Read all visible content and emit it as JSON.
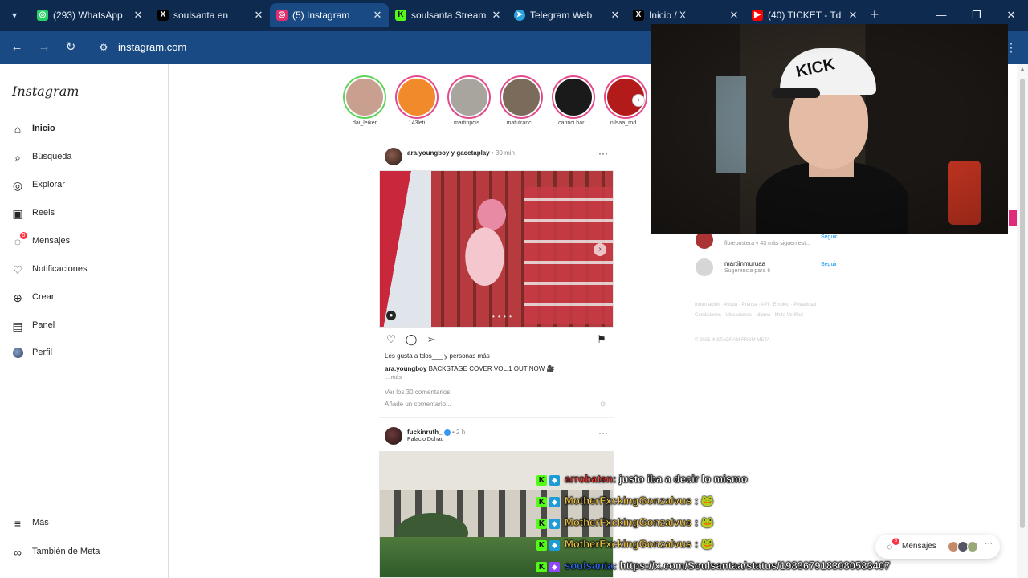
{
  "browser": {
    "tabs": [
      {
        "title": "(293) WhatsApp",
        "icon": "whatsapp-icon",
        "color": "#25d366",
        "glyph": "◎",
        "active": false
      },
      {
        "title": "soulsanta en",
        "icon": "x-icon",
        "color": "#000000",
        "glyph": "X",
        "active": false
      },
      {
        "title": "(5) Instagram",
        "icon": "instagram-icon",
        "color": "#e1306c",
        "glyph": "◎",
        "active": true
      },
      {
        "title": "soulsanta Stream",
        "icon": "kick-icon",
        "color": "#53fc18",
        "glyph": "K",
        "active": false
      },
      {
        "title": "Telegram Web",
        "icon": "telegram-icon",
        "color": "#2aa3df",
        "glyph": "➤",
        "active": false
      },
      {
        "title": "Inicio / X",
        "icon": "x-icon",
        "color": "#000000",
        "glyph": "X",
        "active": false
      },
      {
        "title": "(40) TICKET - Td",
        "icon": "youtube-icon",
        "color": "#ff0000",
        "glyph": "▶",
        "active": false
      }
    ],
    "url": "instagram.com"
  },
  "sidebar": {
    "logo": "Instagram",
    "items": [
      {
        "label": "Inicio",
        "icon": "home-icon",
        "glyph": "⌂"
      },
      {
        "label": "Búsqueda",
        "icon": "search-icon",
        "glyph": "⌕"
      },
      {
        "label": "Explorar",
        "icon": "compass-icon",
        "glyph": "◎"
      },
      {
        "label": "Reels",
        "icon": "reels-icon",
        "glyph": "▣"
      },
      {
        "label": "Mensajes",
        "icon": "messenger-icon",
        "glyph": "◌",
        "badge": "5"
      },
      {
        "label": "Notificaciones",
        "icon": "heart-icon",
        "glyph": "♡"
      },
      {
        "label": "Crear",
        "icon": "plus-icon",
        "glyph": "⊕"
      },
      {
        "label": "Panel",
        "icon": "dashboard-icon",
        "glyph": "▤"
      },
      {
        "label": "Perfil",
        "icon": "avatar",
        "glyph": ""
      },
      {
        "label": "Más",
        "icon": "menu-icon",
        "glyph": "≡"
      },
      {
        "label": "También de Meta",
        "icon": "meta-icon",
        "glyph": "∞"
      }
    ]
  },
  "stories": [
    {
      "name": "dai_leiker",
      "ring": "#5fd35a",
      "color": "#c9a08f"
    },
    {
      "name": "143leti",
      "ring": "#e34a8c",
      "color": "#f08a2a"
    },
    {
      "name": "martinpdis...",
      "ring": "#e34a8c",
      "color": "#a7a59d"
    },
    {
      "name": "matufranc...",
      "ring": "#e34a8c",
      "color": "#7b6b5a"
    },
    {
      "name": "carinci.bar...",
      "ring": "#e34a8c",
      "color": "#1a1a1a"
    },
    {
      "name": "nilsaa_rod...",
      "ring": "#e34a8c",
      "color": "#b31b1b"
    }
  ],
  "post1": {
    "user": "ara.youngboy y gacetaplay",
    "time": " • 30 min",
    "likes": "Les gusta a tdos___ y personas más",
    "caption_user": "ara.youngboy",
    "caption": " BACKSTAGE COVER VOL.1 OUT NOW 🎥",
    "more": "... más",
    "comments": "Ver los 30 comentarios",
    "add_comment": "Añade un comentario...",
    "pager": "• • • •"
  },
  "post2": {
    "user": "fuckinruth_",
    "time": " • 2 h",
    "location": "Palacio Duhau"
  },
  "suggestions": [
    {
      "name": "",
      "sub": "florebostera y 43 más siguen est...",
      "follow": "Seguir",
      "color": "#a33"
    },
    {
      "name": "martiinmuruaa",
      "sub": "Sugerencia para ti",
      "follow": "Seguir",
      "color": "#cfcfcf"
    }
  ],
  "footer": {
    "links": "Información · Ayuda · Prensa · API · Empleo · Privacidad · Condiciones · Ubicaciones · Idioma · Meta Verified",
    "copyright": "© 2025 INSTAGRAM FROM META"
  },
  "chat": [
    {
      "user": "arrobaten",
      "user_color": "#ff3b3b",
      "message": ": justo iba a decir lo mismo",
      "emote": ""
    },
    {
      "user": "MotherFxckingGonzalvus",
      "user_color": "#f2c94c",
      "message": " : ",
      "emote": "🐸"
    },
    {
      "user": "MotherFxckingGonzalvus",
      "user_color": "#f2c94c",
      "message": " : ",
      "emote": "🐸"
    },
    {
      "user": "MotherFxckingGonzalvus",
      "user_color": "#f2c94c",
      "message": " : ",
      "emote": "🐸"
    },
    {
      "user": "soulsanta",
      "user_color": "#2f6fff",
      "message": ": https://x.com/Soulsantaa/status/1983679183080583407",
      "emote": ""
    }
  ],
  "messages_pill": {
    "label": "Mensajes",
    "badge": "5"
  },
  "colors": {
    "chrome_dark": "#0e2a4f",
    "chrome_mid": "#1a4a84",
    "accent": "#0095f6"
  }
}
